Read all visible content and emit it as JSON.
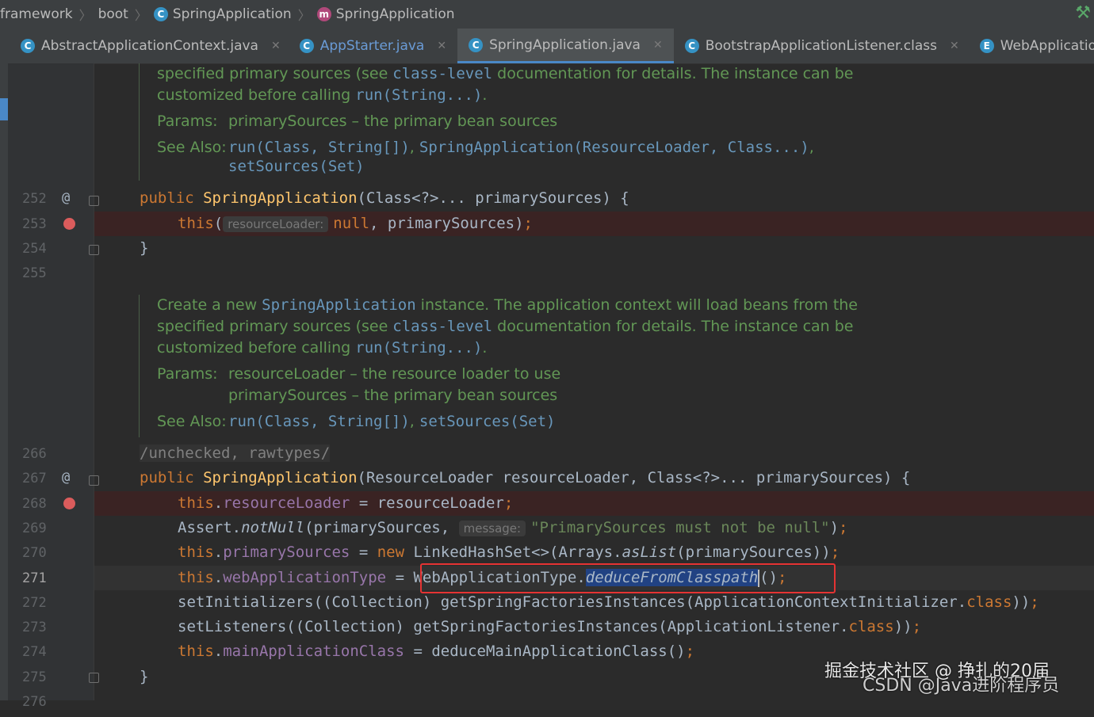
{
  "breadcrumb": {
    "items": [
      "framework",
      "boot",
      "SpringApplication",
      "SpringApplication"
    ]
  },
  "tabs": [
    {
      "label": "AbstractApplicationContext.java",
      "icon": "class-icon"
    },
    {
      "label": "AppStarter.java",
      "icon": "class-icon"
    },
    {
      "label": "SpringApplication.java",
      "icon": "class-icon",
      "active": true
    },
    {
      "label": "BootstrapApplicationListener.class",
      "icon": "class-icon"
    },
    {
      "label": "WebApplicationType.j",
      "icon": "enum-icon"
    }
  ],
  "doc1": {
    "l1a": "specified primary sources (see ",
    "l1b": "class-level",
    "l1c": " documentation for details. The instance can be",
    "l2a": "customized before calling ",
    "l2b": "run(String...)",
    "l2c": ".",
    "params_label": "Params:",
    "param1": "primarySources – the primary bean sources",
    "see_label": "See Also:",
    "see1": "run(Class, String[])",
    "see_sep": ", ",
    "see2": "SpringApplication(ResourceLoader, Class...)",
    "see2_end": ",",
    "see3": "setSources(Set)"
  },
  "doc2": {
    "l1a": "Create a new ",
    "l1b": "SpringApplication",
    "l1c": " instance. The application context will load beans from the",
    "l2a": "specified primary sources (see ",
    "l2b": "class-level",
    "l2c": " documentation for details. The instance can be",
    "l3a": "customized before calling ",
    "l3b": "run(String...)",
    "l3c": ".",
    "params_label": "Params:",
    "param1": "resourceLoader – the resource loader to use",
    "param2": "primarySources – the primary bean sources",
    "see_label": "See Also:",
    "see1": "run(Class, String[])",
    "see_sep": ", ",
    "see2": "setSources(Set)"
  },
  "line_numbers": {
    "n252": "252",
    "n253": "253",
    "n254": "254",
    "n255": "255",
    "n266": "266",
    "n267": "267",
    "n268": "268",
    "n269": "269",
    "n270": "270",
    "n271": "271",
    "n272": "272",
    "n273": "273",
    "n274": "274",
    "n275": "275",
    "n276": "276"
  },
  "code": {
    "l252_kw": "public ",
    "l252_fn": "SpringApplication",
    "l252_rest": "(Class<?>... primarySources) {",
    "l253_kw": "this",
    "l253_p": "(",
    "l253_hint": "resourceLoader:",
    "l253_null": "null",
    "l253_rest": ", primarySources)",
    "l253_semi": ";",
    "l254": "}",
    "l266": "/unchecked, rawtypes/",
    "l267_kw": "public ",
    "l267_fn": "SpringApplication",
    "l267_rest": "(ResourceLoader resourceLoader, Class<?>... primarySources) {",
    "l268_this": "this",
    "l268_dot": ".",
    "l268_fld": "resourceLoader",
    "l268_rest": " = resourceLoader",
    "l268_semi": ";",
    "l269_a": "Assert.",
    "l269_m": "notNull",
    "l269_b": "(primarySources, ",
    "l269_hint": "message:",
    "l269_str": "\"PrimarySources must not be null\"",
    "l269_c": ")",
    "l269_semi": ";",
    "l270_this": "this",
    "l270_dot": ".",
    "l270_fld": "primarySources",
    "l270_eq": " = ",
    "l270_new": "new ",
    "l270_a": "LinkedHashSet<>(Arrays.",
    "l270_m": "asList",
    "l270_b": "(primarySources))",
    "l270_semi": ";",
    "l271_this": "this",
    "l271_dot": ".",
    "l271_fld": "webApplicationType",
    "l271_eq": " = ",
    "l271_a": "WebApplicationType.",
    "l271_m": "deduceFromClasspath",
    "l271_b": "()",
    "l271_semi": ";",
    "l272_a": "setInitializers((Collection) getSpringFactoriesInstances(ApplicationContextInitializer.",
    "l272_kw": "class",
    "l272_b": "))",
    "l272_semi": ";",
    "l273_a": "setListeners((Collection) getSpringFactoriesInstances(ApplicationListener.",
    "l273_kw": "class",
    "l273_b": "))",
    "l273_semi": ";",
    "l274_this": "this",
    "l274_dot": ".",
    "l274_fld": "mainApplicationClass",
    "l274_rest": " = deduceMainApplicationClass()",
    "l274_semi": ";",
    "l275": "}"
  },
  "watermark": {
    "line1": "掘金技术社区 @ 挣扎的20届",
    "line2": "CSDN @Java进阶程序员"
  },
  "colors": {
    "background": "#2b2b2b",
    "keyword": "#cc7832",
    "method": "#ffc66d",
    "field": "#9876aa",
    "doc": "#629755",
    "string": "#6a8759",
    "breakpoint": "#db5c5c",
    "highlight_box": "#e53333"
  }
}
